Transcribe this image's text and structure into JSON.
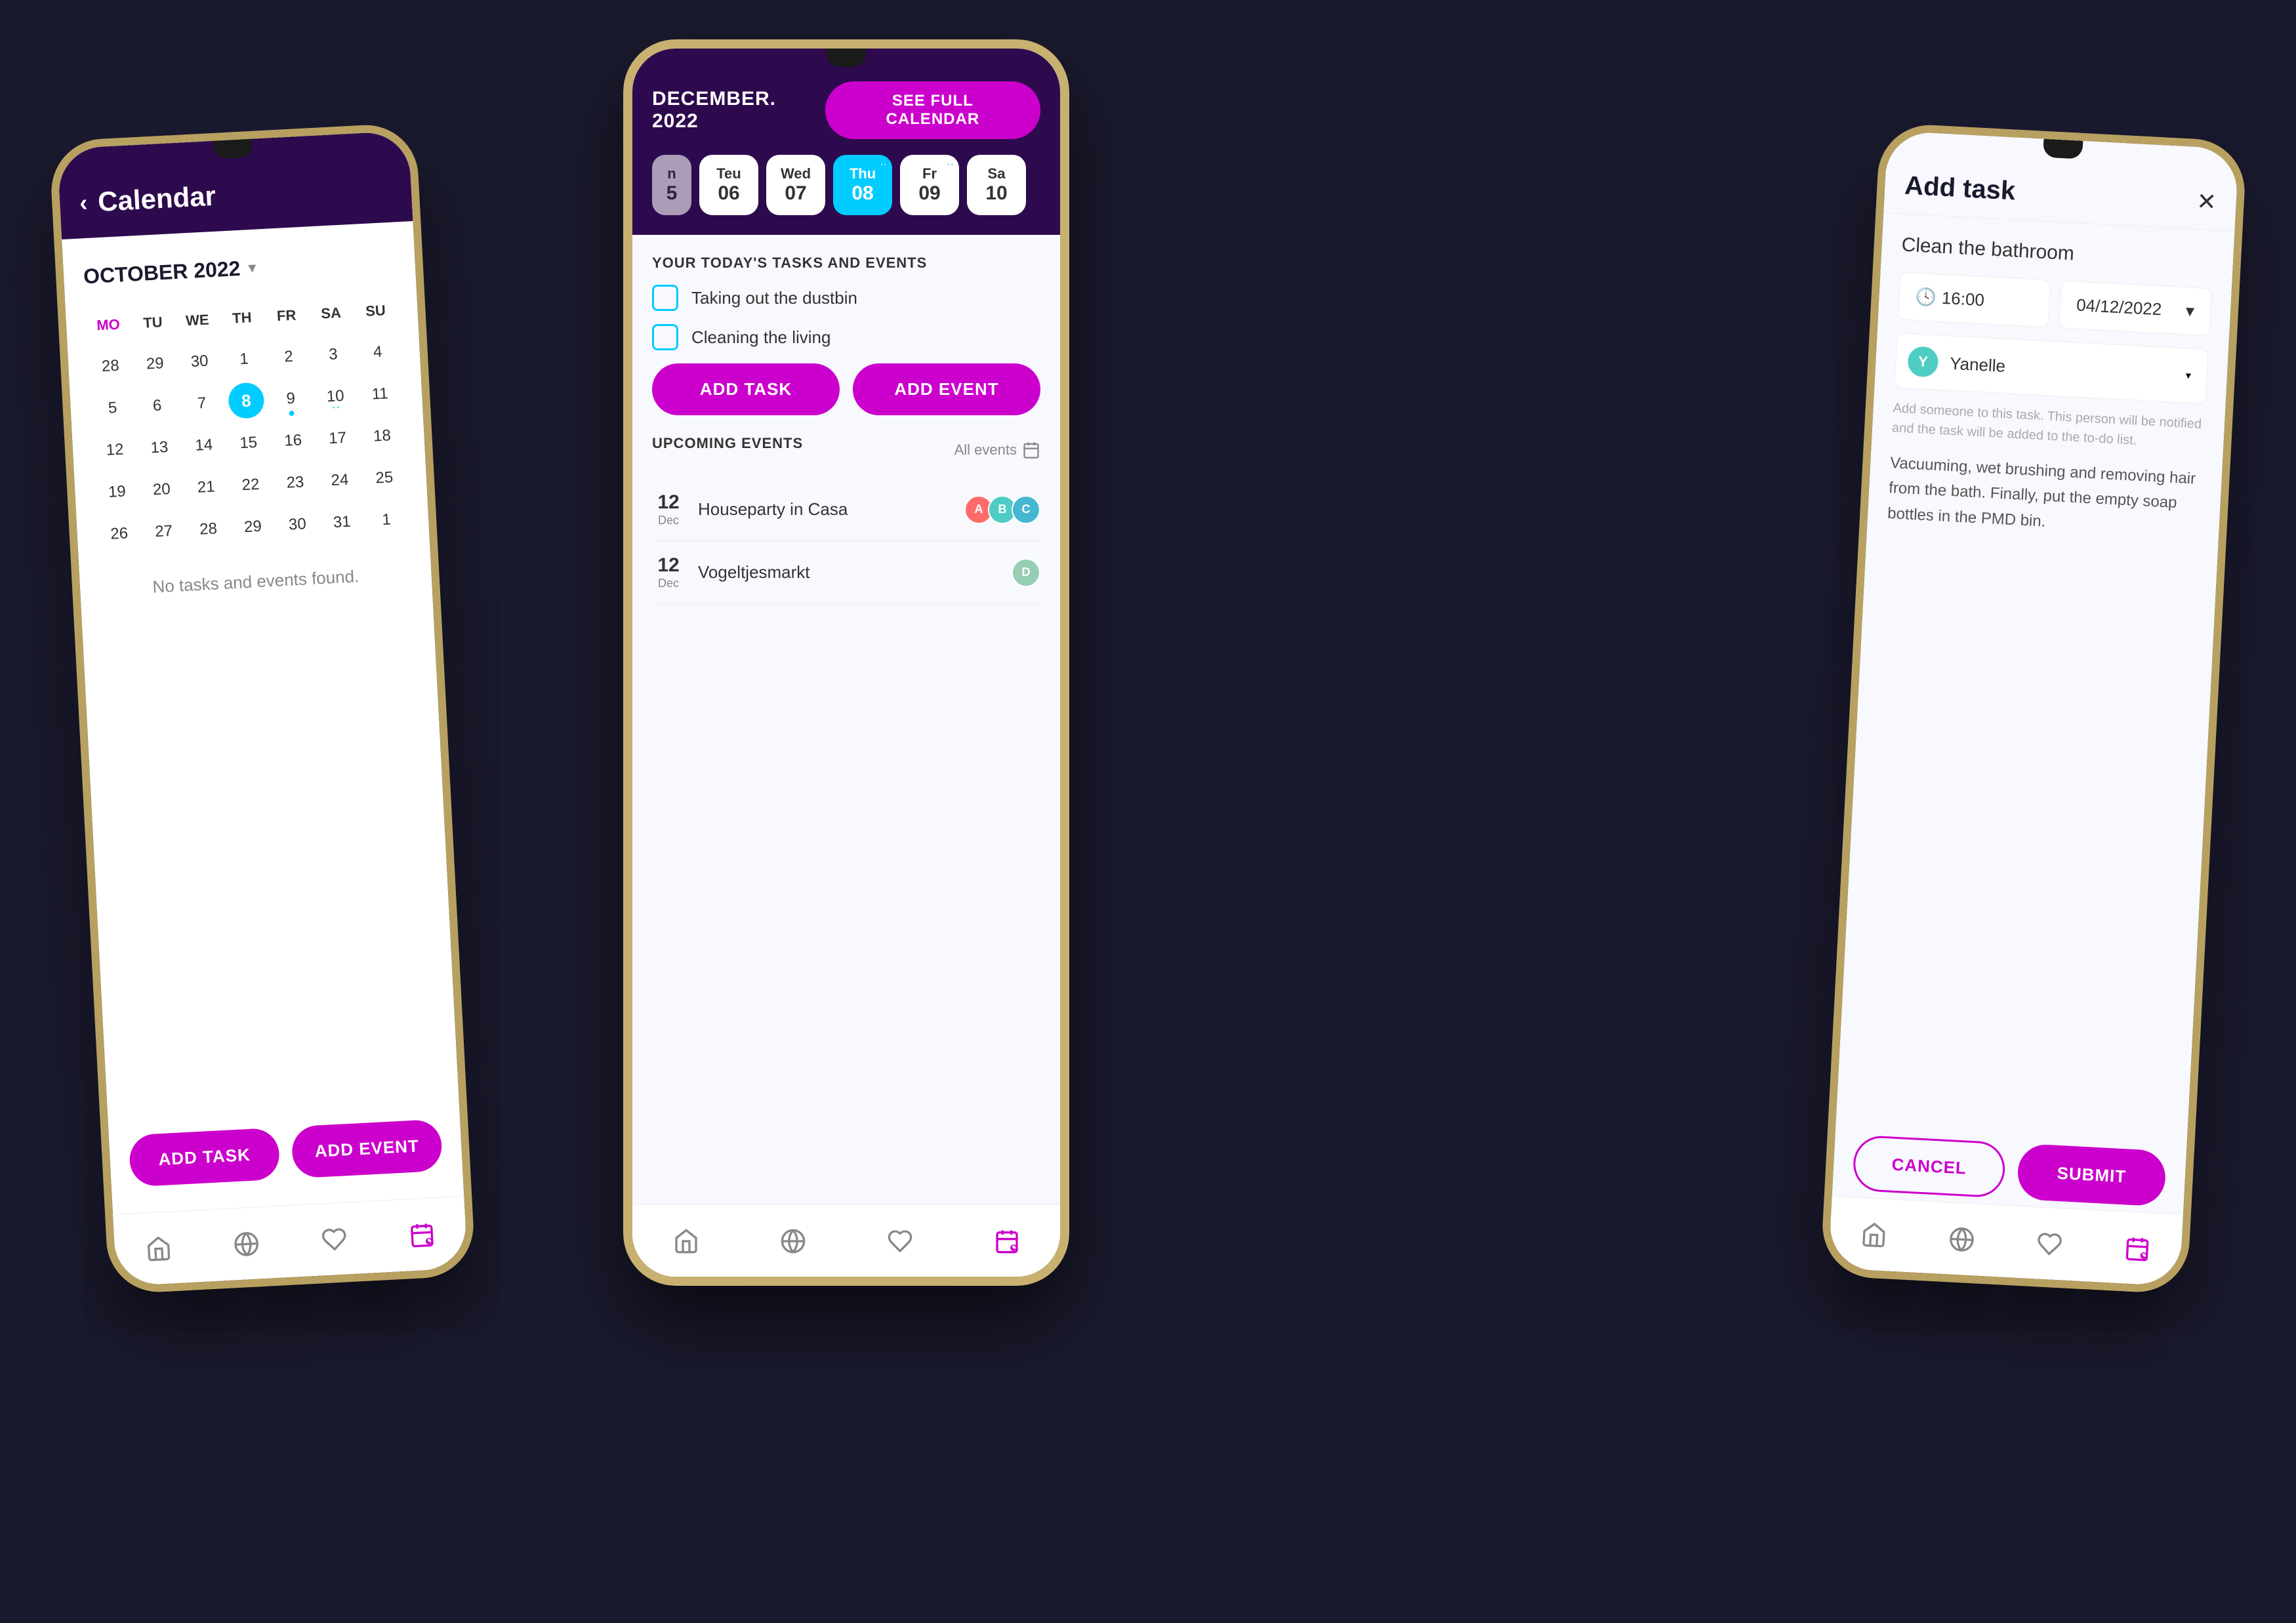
{
  "left_phone": {
    "header": {
      "back_label": "‹",
      "title": "Calendar"
    },
    "month": "OCTOBER 2022",
    "weekdays": [
      "MO",
      "TU",
      "WE",
      "TH",
      "FR",
      "SA",
      "SU"
    ],
    "weeks": [
      [
        "28",
        "29",
        "30",
        "1",
        "2",
        "3",
        "4"
      ],
      [
        "5",
        "6",
        "7",
        "8",
        "9",
        "10",
        "11"
      ],
      [
        "12",
        "13",
        "14",
        "15",
        "16",
        "17",
        "18"
      ],
      [
        "19",
        "20",
        "21",
        "22",
        "23",
        "24",
        "25"
      ],
      [
        "26",
        "27",
        "28",
        "29",
        "30",
        "31",
        "1"
      ]
    ],
    "highlighted_date": "8",
    "no_tasks_text": "No tasks and events found.",
    "btn_add_task": "ADD TASK",
    "btn_add_event": "ADD EVENT",
    "nav": [
      "home",
      "globe",
      "piggy",
      "calendar"
    ]
  },
  "center_phone": {
    "month": "DECEMBER. 2022",
    "see_full_btn": "SEE FULL CALENDAR",
    "days": [
      {
        "name": "n",
        "num": "5",
        "active": false,
        "partial": true
      },
      {
        "name": "Teu",
        "num": "06",
        "active": false,
        "dots": false
      },
      {
        "name": "Wed",
        "num": "07",
        "active": false,
        "dots": false
      },
      {
        "name": "Thu",
        "num": "08",
        "active": true,
        "dots": true
      },
      {
        "name": "Fr",
        "num": "09",
        "active": false,
        "dots": true
      },
      {
        "name": "Sa",
        "num": "10",
        "active": false,
        "dots": false
      }
    ],
    "tasks_section_label": "YOUR TODAY'S TASKS AND EVENTS",
    "tasks": [
      {
        "label": "Taking out the dustbin"
      },
      {
        "label": "Cleaning the living"
      }
    ],
    "btn_add_task": "ADD TASK",
    "btn_add_event": "ADD EVENT",
    "upcoming_label": "UPCOMING EVENTS",
    "all_events_label": "All events",
    "events": [
      {
        "date_num": "12",
        "date_month": "Dec",
        "name": "Houseparty in Casa",
        "avatars": [
          "A",
          "B",
          "C"
        ]
      },
      {
        "date_num": "12",
        "date_month": "Dec",
        "name": "Vogeltjesmarkt",
        "avatars": [
          "D"
        ]
      }
    ],
    "nav": [
      "home",
      "globe",
      "piggy",
      "calendar"
    ]
  },
  "right_phone": {
    "header": {
      "title": "Add task",
      "close": "✕"
    },
    "task_name": "Clean the bathroom",
    "time": "16:00",
    "date": "04/12/2022",
    "assignee": "Yanelle",
    "helper_text": "Add someone to this task. This person will be notified and the task will be added to the to-do list.",
    "description": "Vacuuming, wet brushing and removing hair from the bath. Finally, put the empty soap bottles in the PMD bin.",
    "btn_cancel": "CANCEL",
    "btn_submit": "SUBMIT",
    "nav": [
      "home",
      "globe",
      "piggy",
      "calendar"
    ]
  }
}
